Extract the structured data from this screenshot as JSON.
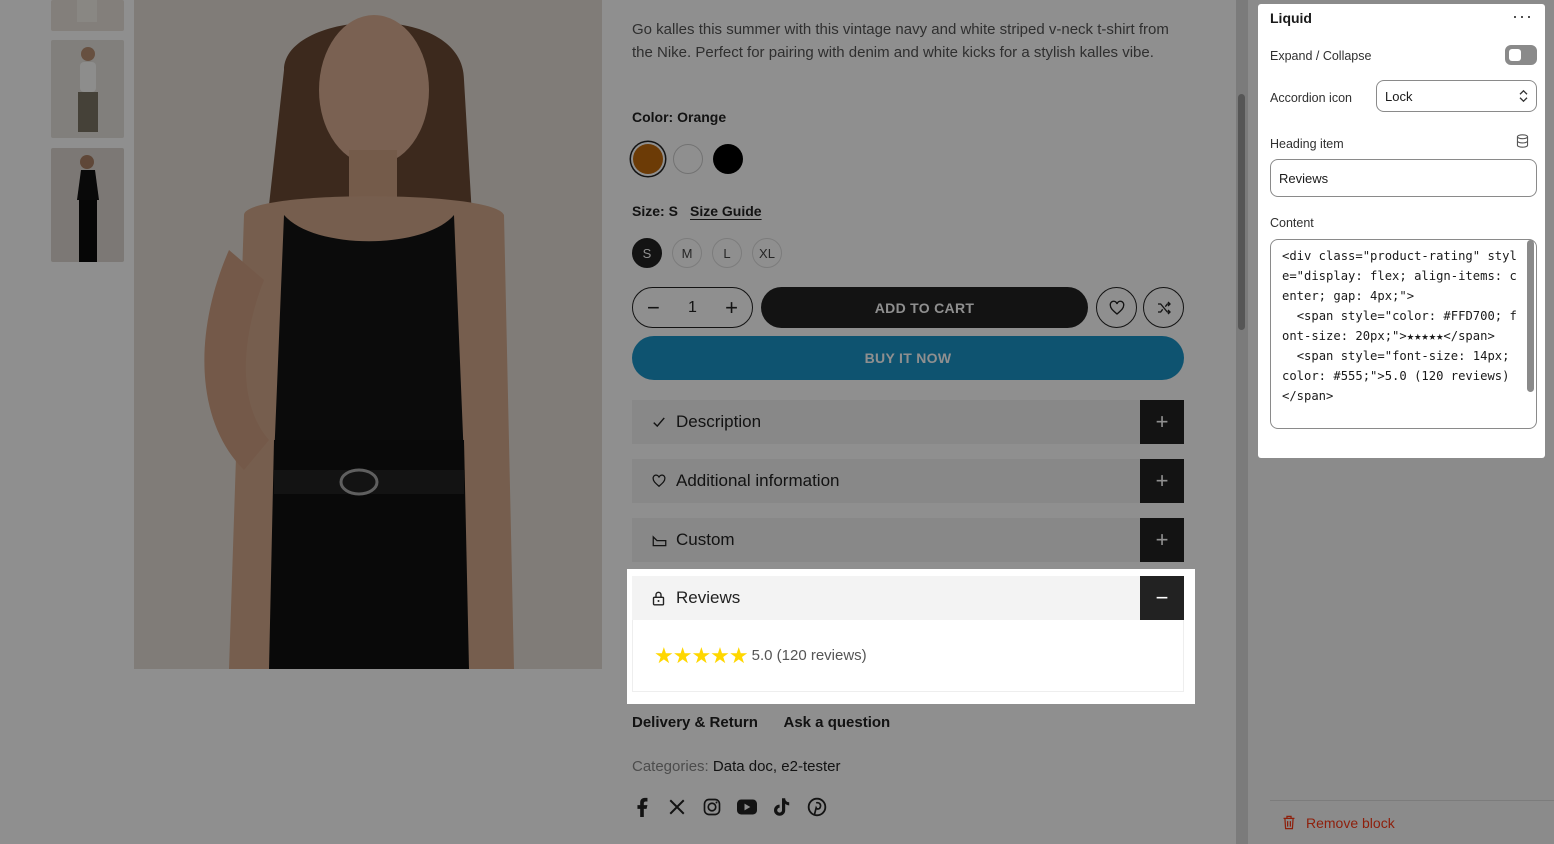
{
  "product": {
    "description": "Go kalles this summer with this vintage navy and white striped v-neck t-shirt from the Nike. Perfect for pairing with denim and white kicks for a stylish kalles vibe.",
    "color_label": "Color: Orange",
    "size_label": "Size: S",
    "size_guide": "Size Guide",
    "sizes": [
      "S",
      "M",
      "L",
      "XL"
    ],
    "quantity": "1",
    "add_to_cart": "ADD TO CART",
    "buy_now": "BUY IT NOW",
    "swatch_colors": [
      "#c1690c",
      "#ffffff",
      "#000000"
    ]
  },
  "accordions": [
    {
      "title": "Description",
      "icon": "check-icon"
    },
    {
      "title": "Additional information",
      "icon": "heart-icon"
    },
    {
      "title": "Custom",
      "icon": "tag-icon"
    },
    {
      "title": "Reviews",
      "icon": "lock-icon"
    }
  ],
  "reviews": {
    "stars": "★★★★★",
    "text": "5.0 (120 reviews)",
    "star_color": "#FFD700"
  },
  "tabs": [
    "Delivery & Return",
    "Ask a question"
  ],
  "categories": {
    "label": "Categories:",
    "value": "Data doc, e2-tester"
  },
  "social_icons": [
    "facebook-icon",
    "x-icon",
    "instagram-icon",
    "youtube-icon",
    "tiktok-icon",
    "pinterest-icon"
  ],
  "editor": {
    "title": "Liquid",
    "more": "···",
    "expand_label": "Expand / Collapse",
    "accordion_icon_label": "Accordion icon",
    "accordion_icon_value": "Lock",
    "heading_label": "Heading item",
    "heading_value": "Reviews",
    "content_label": "Content",
    "content_code": "<div class=\"product-rating\" style=\"display: flex; align-items: center; gap: 4px;\">\n  <span style=\"color: #FFD700; font-size: 20px;\">★★★★★</span>\n  <span style=\"font-size: 14px; color: #555;\">5.0 (120 reviews)</span>",
    "remove_block": "Remove block"
  }
}
